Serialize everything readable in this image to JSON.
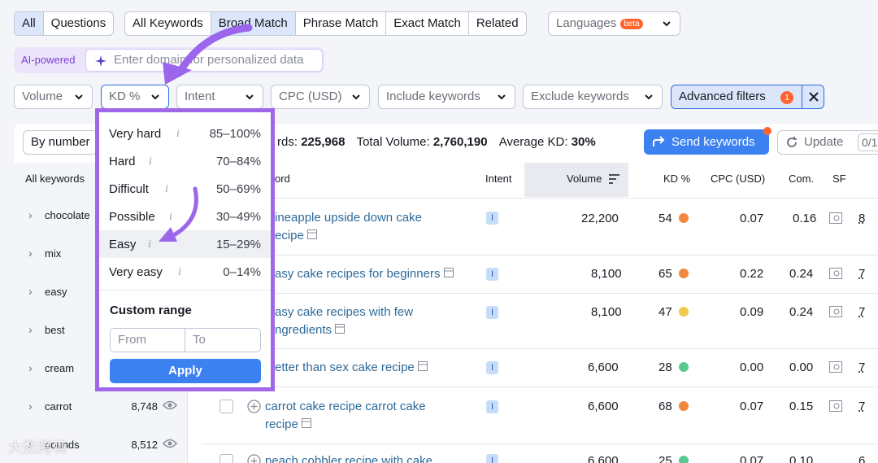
{
  "tabs_group1": [
    "All",
    "Questions"
  ],
  "tabs_group2": [
    "All Keywords",
    "Broad Match",
    "Phrase Match",
    "Exact Match",
    "Related"
  ],
  "languages": {
    "label": "Languages",
    "badge": "beta"
  },
  "ai": {
    "label": "AI-powered",
    "placeholder": "Enter domain for personalized data"
  },
  "filters": {
    "volume": "Volume",
    "kd": "KD %",
    "intent": "Intent",
    "cpc": "CPC (USD)",
    "include": "Include keywords",
    "exclude": "Exclude keywords",
    "advanced": "Advanced filters",
    "advanced_count": "1"
  },
  "kd_dropdown": {
    "items": [
      {
        "label": "Very hard",
        "range": "85–100%"
      },
      {
        "label": "Hard",
        "range": "70–84%"
      },
      {
        "label": "Difficult",
        "range": "50–69%"
      },
      {
        "label": "Possible",
        "range": "30–49%"
      },
      {
        "label": "Easy",
        "range": "15–29%"
      },
      {
        "label": "Very easy",
        "range": "0–14%"
      }
    ],
    "info_glyph": "i",
    "custom_range": "Custom range",
    "from_placeholder": "From",
    "to_placeholder": "To",
    "apply": "Apply"
  },
  "toolbar": {
    "by_number": "By number",
    "keywords_label_partial": "rds:",
    "keywords_count": "225,968",
    "total_volume_label": "Total Volume:",
    "total_volume": "2,760,190",
    "avg_kd_label": "Average KD:",
    "avg_kd": "30%",
    "send_keywords": "Send keywords",
    "update": "Update",
    "update_count": "0/1,"
  },
  "sidebar": {
    "header": "All keywords",
    "items": [
      {
        "label": "chocolate",
        "count": ""
      },
      {
        "label": "mix",
        "count": ""
      },
      {
        "label": "easy",
        "count": ""
      },
      {
        "label": "best",
        "count": ""
      },
      {
        "label": "cream",
        "count": ""
      },
      {
        "label": "carrot",
        "count": "8,748"
      },
      {
        "label": "pounds",
        "count": "8,512"
      }
    ]
  },
  "table": {
    "headers": {
      "keyword": "ord",
      "intent": "Intent",
      "volume": "Volume",
      "kd": "KD %",
      "cpc": "CPC (USD)",
      "com": "Com.",
      "sf": "SF"
    },
    "rows": [
      {
        "kw1": "ineapple upside down cake",
        "kw2": "ecipe",
        "intent": "I",
        "volume": "22,200",
        "kd": "54",
        "kd_color": "#f0883d",
        "cpc": "0.07",
        "com": "0.16",
        "sf": "8"
      },
      {
        "kw1": "asy cake recipes for beginners",
        "kw2": "",
        "intent": "I",
        "volume": "8,100",
        "kd": "65",
        "kd_color": "#f0883d",
        "cpc": "0.22",
        "com": "0.24",
        "sf": "7"
      },
      {
        "kw1": "asy cake recipes with few",
        "kw2": "ngredients",
        "intent": "I",
        "volume": "8,100",
        "kd": "47",
        "kd_color": "#f2c94c",
        "cpc": "0.09",
        "com": "0.24",
        "sf": "7"
      },
      {
        "kw1": "etter than sex cake recipe",
        "kw2": "",
        "intent": "I",
        "volume": "6,600",
        "kd": "28",
        "kd_color": "#59c98f",
        "cpc": "0.00",
        "com": "0.00",
        "sf": "7"
      },
      {
        "kw1": "carrot cake recipe carrot cake",
        "kw2": "recipe",
        "intent": "I",
        "volume": "6,600",
        "kd": "68",
        "kd_color": "#f0883d",
        "cpc": "0.07",
        "com": "0.15",
        "sf": "7"
      },
      {
        "kw1": "peach cobbler recipe with cake",
        "kw2": "",
        "intent": "I",
        "volume": "6,600",
        "kd": "25",
        "kd_color": "#59c98f",
        "cpc": "0.07",
        "com": "0.10",
        "sf": "6"
      }
    ]
  },
  "watermark": "大数跨境",
  "colors": {
    "accent": "#2d6be4",
    "highlight_border": "#a067e8",
    "send_button": "#3b82f0"
  }
}
